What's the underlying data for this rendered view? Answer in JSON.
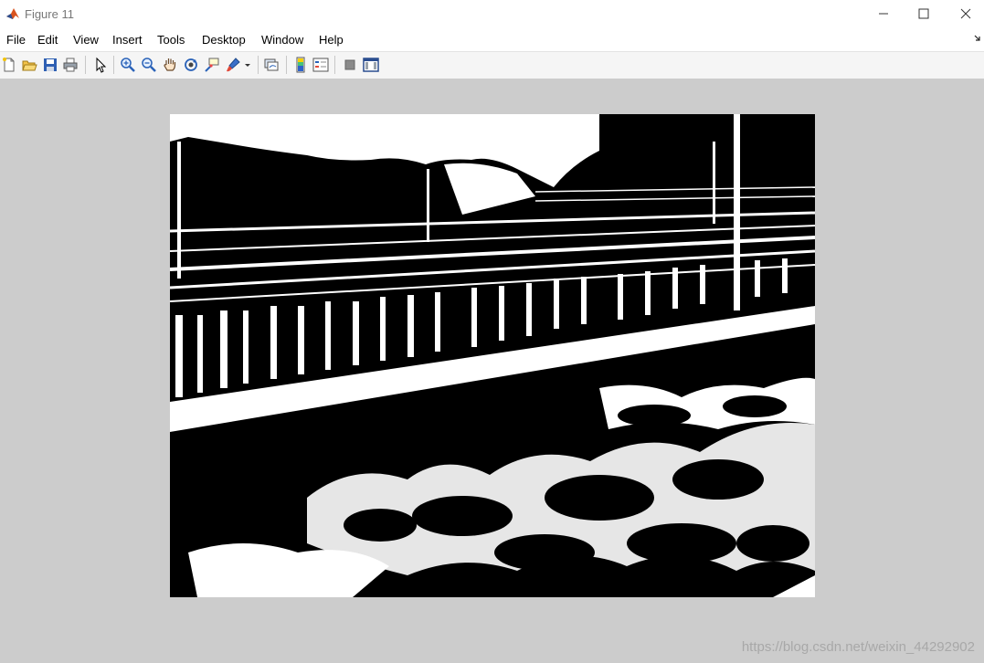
{
  "window": {
    "title": "Figure 11",
    "controls": {
      "minimize": "minimize-icon",
      "maximize": "maximize-icon",
      "close": "close-icon"
    }
  },
  "menu": {
    "items": [
      "File",
      "Edit",
      "View",
      "Insert",
      "Tools",
      "Desktop",
      "Window",
      "Help"
    ]
  },
  "toolbar": {
    "buttons": [
      "new-figure-icon",
      "open-file-icon",
      "save-icon",
      "print-icon",
      "pointer-icon",
      "zoom-in-icon",
      "zoom-out-icon",
      "pan-hand-icon",
      "rotate-3d-icon",
      "data-cursor-icon",
      "brush-icon",
      "link-plot-icon",
      "colorbar-icon",
      "legend-icon",
      "hide-plot-tools-icon",
      "show-plot-tools-icon"
    ]
  },
  "figure": {
    "background": "#cccccc",
    "image_description_colors": {
      "foreground": "#000000",
      "background": "#ffffff"
    }
  },
  "watermark": {
    "text": "https://blog.csdn.net/weixin_44292902"
  }
}
